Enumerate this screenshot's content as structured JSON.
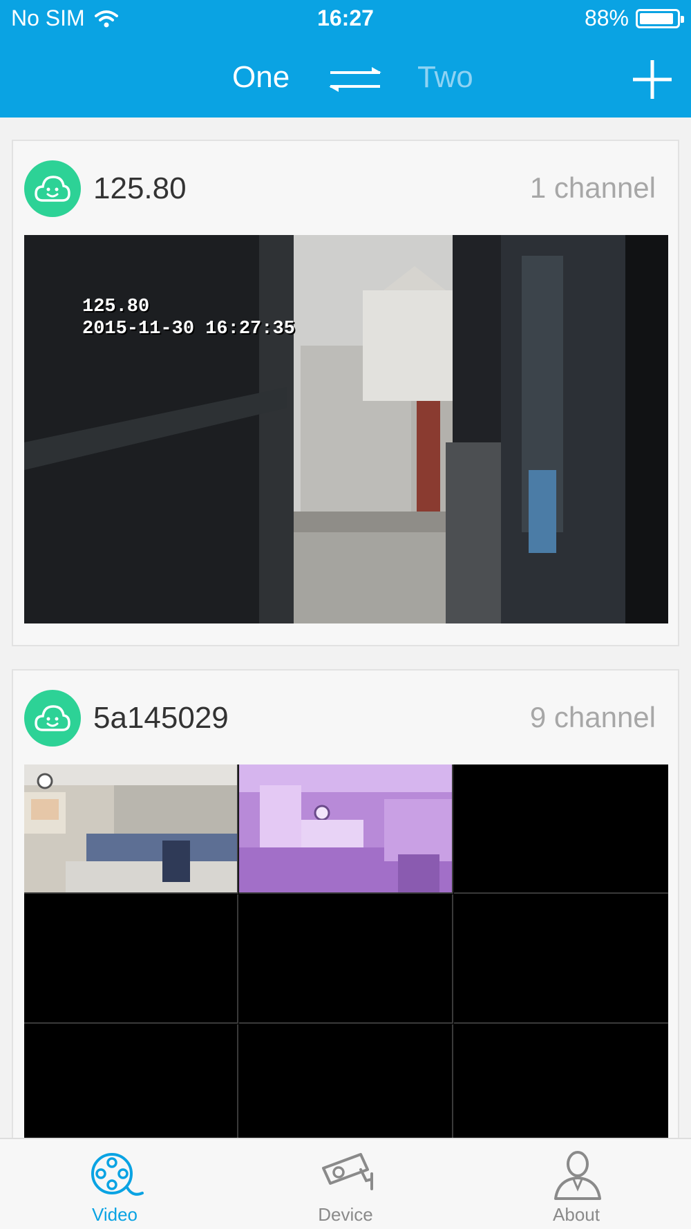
{
  "status_bar": {
    "carrier": "No SIM",
    "time": "16:27",
    "battery_percent": "88%",
    "battery_level": 0.88,
    "wifi_icon": "wifi-icon"
  },
  "header": {
    "tab_one": "One",
    "tab_two": "Two",
    "swap_icon": "swap-arrows-icon",
    "add_icon": "plus-icon",
    "background_color": "#0aa3e3"
  },
  "devices": [
    {
      "name": "125.80",
      "channels": "1 channel",
      "icon": "cloud-smile-icon",
      "badge_color": "#2dd296",
      "osd_line1": "125.80",
      "osd_line2": "2015-11-30 16:27:35"
    },
    {
      "name": "5a145029",
      "channels": "9 channel",
      "icon": "cloud-smile-icon",
      "badge_color": "#2dd296"
    }
  ],
  "tabbar": {
    "items": [
      {
        "label": "Video",
        "icon": "film-reel-icon",
        "active": true
      },
      {
        "label": "Device",
        "icon": "security-camera-icon",
        "active": false
      },
      {
        "label": "About",
        "icon": "person-icon",
        "active": false
      }
    ],
    "active_color": "#0aa3e3"
  }
}
